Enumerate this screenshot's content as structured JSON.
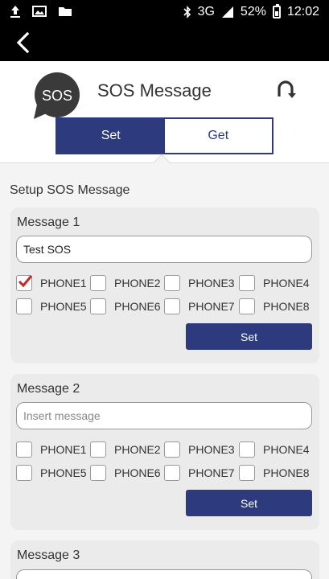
{
  "status_bar": {
    "network": "3G",
    "battery": "52%",
    "time": "12:02"
  },
  "header": {
    "logo_text": "SOS",
    "title": "SOS Message",
    "tabs": {
      "set": "Set",
      "get": "Get"
    }
  },
  "section_title": "Setup SOS Message",
  "messages": [
    {
      "title": "Message 1",
      "value": "Test SOS",
      "placeholder": "",
      "phones": [
        "PHONE1",
        "PHONE2",
        "PHONE3",
        "PHONE4",
        "PHONE5",
        "PHONE6",
        "PHONE7",
        "PHONE8"
      ],
      "checked": [
        true,
        false,
        false,
        false,
        false,
        false,
        false,
        false
      ],
      "button": "Set"
    },
    {
      "title": "Message 2",
      "value": "",
      "placeholder": "Insert message",
      "phones": [
        "PHONE1",
        "PHONE2",
        "PHONE3",
        "PHONE4",
        "PHONE5",
        "PHONE6",
        "PHONE7",
        "PHONE8"
      ],
      "checked": [
        false,
        false,
        false,
        false,
        false,
        false,
        false,
        false
      ],
      "button": "Set"
    },
    {
      "title": "Message 3"
    }
  ],
  "colors": {
    "primary": "#2e3a7e",
    "check": "#c62828",
    "card_bg": "#ebebeb"
  }
}
